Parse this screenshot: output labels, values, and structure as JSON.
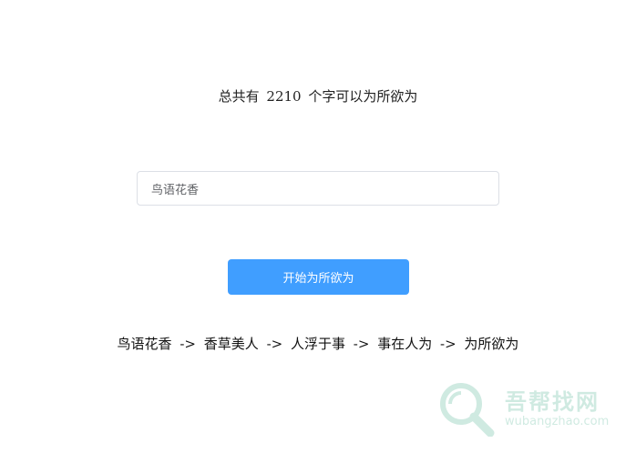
{
  "headline": {
    "prefix": "总共有",
    "count": "2210",
    "suffix": "个字可以为所欲为"
  },
  "search": {
    "value": "鸟语花香",
    "placeholder": ""
  },
  "start_button": {
    "label": "开始为所欲为"
  },
  "result_chain": {
    "items": [
      "鸟语花香",
      "香草美人",
      "人浮于事",
      "事在人为",
      "为所欲为"
    ],
    "separator": "->"
  },
  "watermark": {
    "title": "吾帮找网",
    "domain": "wubangzhao.com",
    "icon": "magnifier-logo-icon",
    "color": "#2aa17b"
  },
  "colors": {
    "primary_button": "#409eff",
    "input_border": "#dcdfe6",
    "text": "#222222"
  }
}
